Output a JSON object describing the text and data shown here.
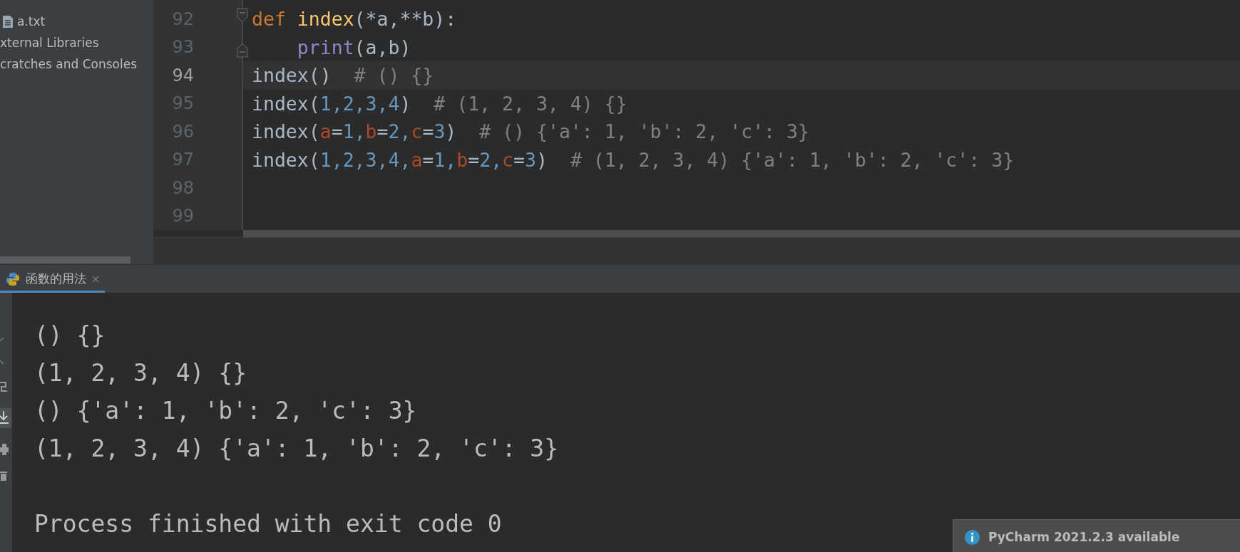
{
  "project_tree": {
    "items": [
      {
        "label": "a.txt",
        "kind": "file"
      },
      {
        "label": "xternal Libraries",
        "kind": "plain"
      },
      {
        "label": "cratches and Consoles",
        "kind": "plain"
      }
    ]
  },
  "editor": {
    "lines": [
      {
        "number": "92",
        "current": false,
        "kind": "fold_start",
        "tokens": [
          {
            "kind": "keyword",
            "text": "def"
          },
          {
            "kind": "func",
            "text": " index"
          },
          {
            "kind": "plain",
            "text": "(*a,**b):"
          }
        ]
      },
      {
        "number": "93",
        "current": false,
        "kind": "fold_end",
        "tokens": [
          {
            "kind": "builtin",
            "text": "    print"
          },
          {
            "kind": "plain",
            "text": "(a,b)"
          }
        ]
      },
      {
        "number": "94",
        "current": true,
        "kind": "plain",
        "tokens": [
          {
            "kind": "plain",
            "text": "index()"
          },
          {
            "kind": "comment",
            "text": "  # () {}"
          }
        ]
      },
      {
        "number": "95",
        "current": false,
        "kind": "plain",
        "tokens": [
          {
            "kind": "plain",
            "text": "index("
          },
          {
            "kind": "number",
            "text": "1,2,3,4"
          },
          {
            "kind": "plain",
            "text": ")"
          },
          {
            "kind": "comment",
            "text": "  # (1, 2, 3, 4) {}"
          }
        ]
      },
      {
        "number": "96",
        "current": false,
        "kind": "plain",
        "tokens": [
          {
            "kind": "plain",
            "text": "index("
          },
          {
            "kind": "param",
            "text": "a"
          },
          {
            "kind": "plain",
            "text": "="
          },
          {
            "kind": "number",
            "text": "1,"
          },
          {
            "kind": "param",
            "text": "b"
          },
          {
            "kind": "plain",
            "text": "="
          },
          {
            "kind": "number",
            "text": "2,"
          },
          {
            "kind": "param",
            "text": "c"
          },
          {
            "kind": "plain",
            "text": "="
          },
          {
            "kind": "number",
            "text": "3"
          },
          {
            "kind": "plain",
            "text": ")"
          },
          {
            "kind": "comment",
            "text": "  # () {'a': 1, 'b': 2, 'c': 3}"
          }
        ]
      },
      {
        "number": "97",
        "current": false,
        "kind": "plain",
        "tokens": [
          {
            "kind": "plain",
            "text": "index("
          },
          {
            "kind": "number",
            "text": "1,2,3,4,"
          },
          {
            "kind": "param",
            "text": "a"
          },
          {
            "kind": "plain",
            "text": "="
          },
          {
            "kind": "number",
            "text": "1,"
          },
          {
            "kind": "param",
            "text": "b"
          },
          {
            "kind": "plain",
            "text": "="
          },
          {
            "kind": "number",
            "text": "2,"
          },
          {
            "kind": "param",
            "text": "c"
          },
          {
            "kind": "plain",
            "text": "="
          },
          {
            "kind": "number",
            "text": "3"
          },
          {
            "kind": "plain",
            "text": ")"
          },
          {
            "kind": "comment",
            "text": "  # (1, 2, 3, 4) {'a': 1, 'b': 2, 'c': 3}"
          }
        ]
      },
      {
        "number": "98",
        "current": false,
        "kind": "plain"
      },
      {
        "number": "99",
        "current": false,
        "kind": "plain"
      }
    ]
  },
  "run_panel": {
    "tab": {
      "label": "函数的用法",
      "selected": true
    },
    "output": [
      "() {}",
      "(1, 2, 3, 4) {}",
      "() {'a': 1, 'b': 2, 'c': 3}",
      "(1, 2, 3, 4) {'a': 1, 'b': 2, 'c': 3}"
    ],
    "exit_message": "Process finished with exit code 0"
  },
  "notification": {
    "title": "PyCharm 2021.2.3 available"
  }
}
